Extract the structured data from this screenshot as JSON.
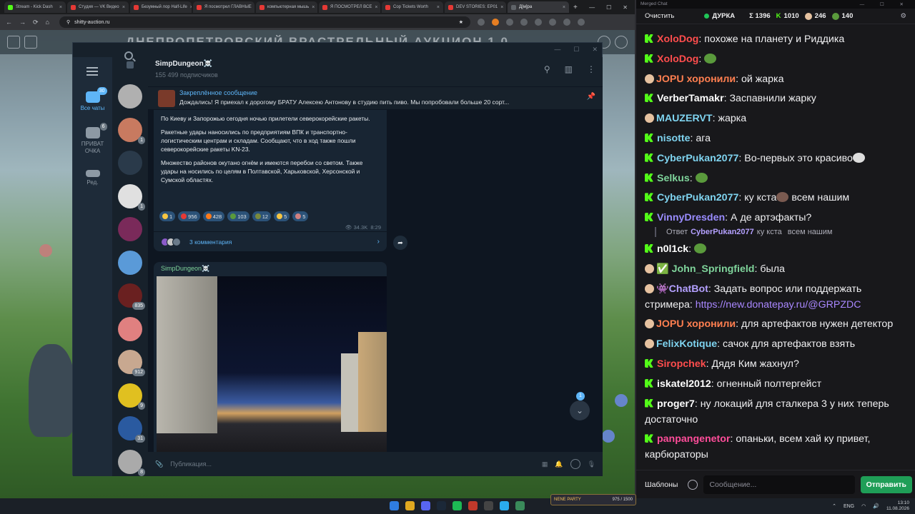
{
  "browser": {
    "tabs": [
      {
        "label": "Stream - Kick Dash",
        "color": "#53fc18"
      },
      {
        "label": "Студия — VK Видео",
        "color": "#e53935"
      },
      {
        "label": "Безумный лор Half-Life",
        "color": "#e53935"
      },
      {
        "label": "Я посмотрел ГЛАВНЫЕ",
        "color": "#e53935"
      },
      {
        "label": "компьютерная мышь",
        "color": "#e53935"
      },
      {
        "label": "Я ПОСМОТРЕЛ ВСЕ",
        "color": "#e53935"
      },
      {
        "label": "Cop Tickets Worth",
        "color": "#e53935"
      },
      {
        "label": "DEV STORIES: EP01",
        "color": "#e53935"
      },
      {
        "label": "Д[м]ра",
        "color": "#5f6368"
      }
    ],
    "url": "shitty-auction.ru",
    "new_tab": "+"
  },
  "site": {
    "title": "ДНЕПРОПЕТРОВСКИЙ ВРАСТРЕЛЬНЫЙ АУКЦИОН 1.0"
  },
  "telegram": {
    "channel_name": "SimpDungeon☠️",
    "subscribers": "155 499 подписчиков",
    "folders": [
      {
        "label": "Все чаты",
        "badge": "30"
      },
      {
        "label": "ПРИВАТ ОЧКА",
        "badge": "6"
      },
      {
        "label": "Ред.",
        "badge": ""
      }
    ],
    "chat_badges": [
      "",
      "1",
      "",
      "1",
      "",
      "",
      "835",
      "",
      "912",
      "9",
      "31",
      "8"
    ],
    "pinned": {
      "title": "Закреплённое сообщение",
      "text": "Дождались!   Я приехал к дорогому БРАТУ Алексею Антонову в студию пить пиво. Мы попробовали больше 20 сорт..."
    },
    "post": {
      "paragraphs": [
        "По Киеву и Запорожью сегодня ночью прилетели северокорейские ракеты.",
        "Ракетные удары наносились по предприятиям ВПК и транспортно-логистическим центрам и складам. Сообщают, что в ход также пошли северокорейские ракеты KN-23.",
        "Множество районов окутано огнём и имеются перебои со светом. Также удары на носились по целям в Полтавской, Харьковской, Херсонской и Сумской областях."
      ],
      "reactions": [
        {
          "emoji": "star",
          "count": "1",
          "color": "#f5c542"
        },
        {
          "emoji": "heart",
          "count": "956",
          "color": "#e53935"
        },
        {
          "emoji": "fire",
          "count": "428",
          "color": "#ff7a1a"
        },
        {
          "emoji": "pepe",
          "count": "103",
          "color": "#5a9a3c"
        },
        {
          "emoji": "pepe-gun",
          "count": "12",
          "color": "#7a8a3c"
        },
        {
          "emoji": "laugh",
          "count": "5",
          "color": "#f5c542"
        },
        {
          "emoji": "face",
          "count": "5",
          "color": "#d08080"
        }
      ],
      "views": "34.3K",
      "time": "8:29",
      "comments": "3 комментария"
    },
    "post2_author": "SimpDungeon☠️",
    "composer_placeholder": "Публикация...",
    "unread_count": "1"
  },
  "chat": {
    "window_title": "Merged Chat",
    "clear": "Очистить",
    "stats": {
      "name": "ДУРКА",
      "sigma": "Σ 1396",
      "kick": "1010",
      "other": "246",
      "viewers": "140"
    },
    "messages": [
      {
        "platform": "kick",
        "user": "XoloDog",
        "color": "#ff4d4d",
        "text": "похоже на планету и Риддика"
      },
      {
        "platform": "kick",
        "user": "XoloDog",
        "color": "#ff4d4d",
        "text": "",
        "emote": "pepe"
      },
      {
        "platform": "vk",
        "user": "JOPU хоронили",
        "color": "#ff7f50",
        "text": "ой жарка"
      },
      {
        "platform": "kick",
        "user": "VerberTamakr",
        "color": "#ffffff",
        "text": "Заспавнили жарку"
      },
      {
        "platform": "vk",
        "user": "MAUZERVT",
        "color": "#7fd4f0",
        "text": "жарка"
      },
      {
        "platform": "kick",
        "user": "nisotte",
        "color": "#7fd4f0",
        "text": "ага"
      },
      {
        "platform": "kick",
        "user": "CyberPukan2077",
        "color": "#7fd4f0",
        "text": "Во-первых это красиво",
        "emote": "face-w"
      },
      {
        "platform": "kick",
        "user": "Selkus",
        "color": "#7fd49b",
        "text": "",
        "emote": "pepe"
      },
      {
        "platform": "kick",
        "user": "CyberPukan2077",
        "color": "#7fd4f0",
        "text": "ку кста",
        "emote": "face-b",
        "after": "всем нашим"
      },
      {
        "platform": "kick",
        "user": "VinnyDresden",
        "color": "#9a8cff",
        "text": "А де артэфакты?"
      },
      {
        "platform": "kick",
        "user": "n0l1ck",
        "color": "#ffffff",
        "text": "",
        "emote": "pepe"
      },
      {
        "platform": "vk",
        "user": "✅ John_Springfield",
        "color": "#7fd49b",
        "text": "была"
      },
      {
        "platform": "vk",
        "user": "👾ChatBot",
        "color": "#b4a0ff",
        "text": "Задать вопрос или поддержать стримера: ",
        "link": "https://new.donatepay.ru/@GRPZDC"
      },
      {
        "platform": "vk",
        "user": "JOPU хоронили",
        "color": "#ff7f50",
        "text": "для артефактов нужен детектор"
      },
      {
        "platform": "vk",
        "user": "FelixKotique",
        "color": "#7fd4f0",
        "text": "сачок для артефактов взять"
      },
      {
        "platform": "kick",
        "user": "Siropchek",
        "color": "#ff4d4d",
        "text": "Дядя Ким жахнул?"
      },
      {
        "platform": "kick",
        "user": "iskatel2012",
        "color": "#ffffff",
        "text": "огненный полтергейст"
      },
      {
        "platform": "kick",
        "user": "proger7",
        "color": "#ffffff",
        "text": "ну локаций для сталкера 3 у них теперь достаточно"
      },
      {
        "platform": "kick",
        "user": "panpangenetor",
        "color": "#ff4d9a",
        "text": "опаньки, всем хай ку привет, карбюраторы"
      }
    ],
    "reply": {
      "prefix": "Ответ",
      "user": "CyberPukan2077",
      "text": "ку кста",
      "after": "всем нашим"
    },
    "templates": "Шаблоны",
    "input_placeholder": "Сообщение...",
    "send": "Отправить"
  },
  "taskbar": {
    "overlay_text": "NENE PARTY",
    "overlay_value": "975 / 1500",
    "lang": "ENG",
    "time": "13:10",
    "date": "11.08.2026"
  }
}
